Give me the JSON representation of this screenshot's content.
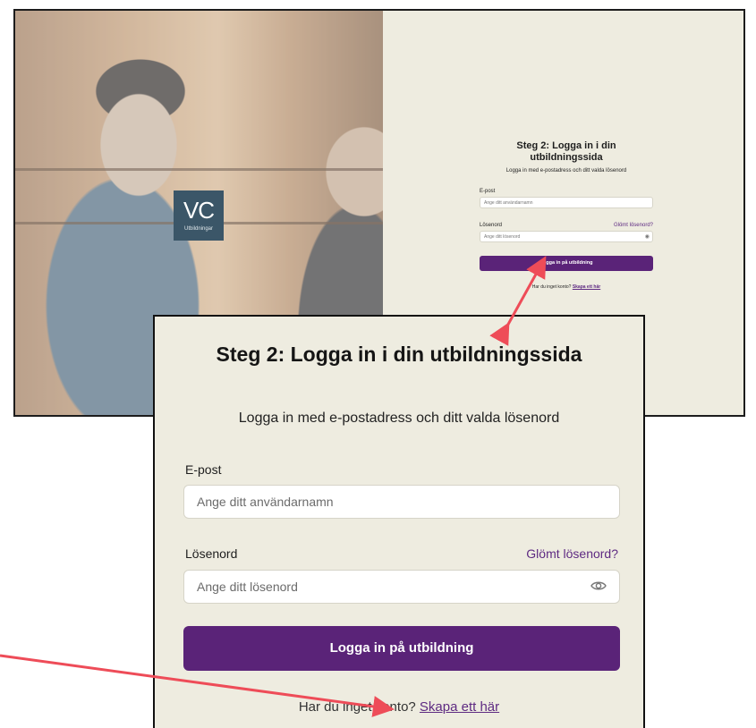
{
  "logo": {
    "mark": "VC",
    "sub": "Utbildningar"
  },
  "login": {
    "title": "Steg 2: Logga in i din utbildningssida",
    "subtitle": "Logga in med e-postadress och ditt valda lösenord",
    "email_label": "E-post",
    "email_placeholder": "Ange ditt användarnamn",
    "password_label": "Lösenord",
    "forgot_link": "Glömt lösenord?",
    "password_placeholder": "Ange ditt lösenord",
    "submit_label": "Logga in på utbildning",
    "no_account_text": "Har du inget konto?",
    "create_link": "Skapa ett här"
  },
  "colors": {
    "panel_bg": "#eeece0",
    "accent": "#5a2378",
    "link": "#5e2a82",
    "annotation_arrow": "#ee4c58",
    "logo_bg": "#3b5668"
  },
  "icons": {
    "password_toggle": "eye-icon"
  }
}
